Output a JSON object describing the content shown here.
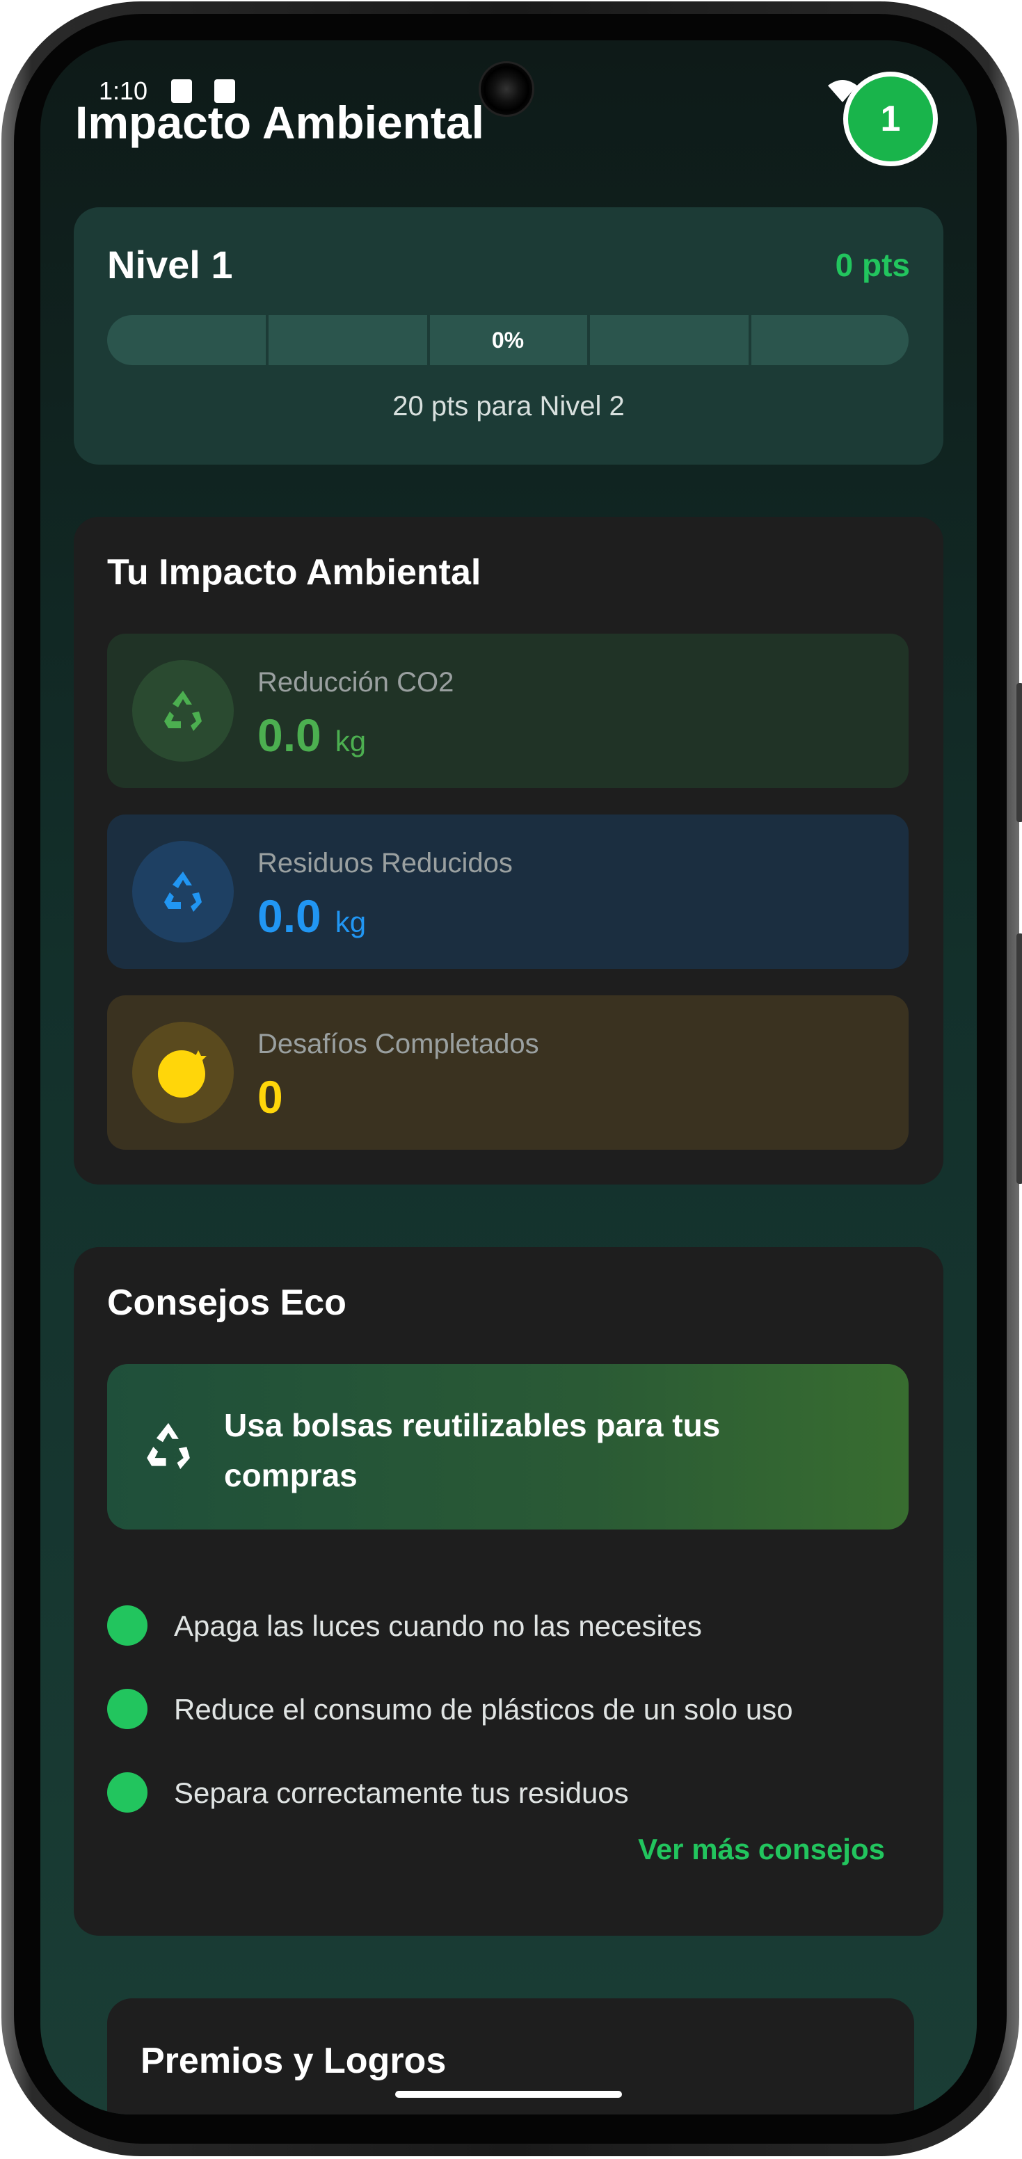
{
  "status_bar": {
    "time": "1:10",
    "icons": [
      "a-notification-icon",
      "sd-card-icon",
      "wifi-icon",
      "signal-icon",
      "battery-icon"
    ]
  },
  "header": {
    "title": "Impacto Ambiental",
    "avatar_level": "1"
  },
  "level": {
    "title": "Nivel 1",
    "points": "0 pts",
    "progress_label": "0%",
    "progress_fraction": 0,
    "next_level_text": "20 pts para Nivel 2"
  },
  "impact": {
    "title": "Tu Impacto Ambiental",
    "stats": [
      {
        "label": "Reducción CO2",
        "value": "0.0",
        "unit": "kg",
        "icon": "recycle-icon",
        "color": "#4caf50"
      },
      {
        "label": "Residuos Reducidos",
        "value": "0.0",
        "unit": "kg",
        "icon": "recycle-icon",
        "color": "#2196f3"
      },
      {
        "label": "Desafíos Completados",
        "value": "0",
        "unit": "",
        "icon": "badge-icon",
        "color": "#ffd60a"
      }
    ]
  },
  "tips": {
    "title": "Consejos Eco",
    "featured": "Usa bolsas reutilizables para tus compras",
    "items": [
      "Apaga las luces cuando no las necesites",
      "Reduce el consumo de plásticos de un solo uso",
      "Separa correctamente tus residuos"
    ],
    "more_link": "Ver más consejos"
  },
  "awards": {
    "title": "Premios y Logros"
  },
  "colors": {
    "accent": "#22c55e",
    "card_bg": "#1e1e1e",
    "level_card_bg": "#1c3b36"
  }
}
